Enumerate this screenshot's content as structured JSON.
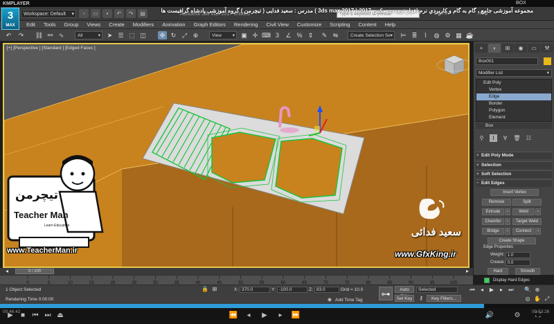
{
  "player": {
    "brand": "KMPLAYER",
    "video_title": "مجموعه آموزشی جامع ، گام به گام و کاربردی نرم افزار تری دی مکس 2017 ( 3ds max 2017 ) مدرس : سعید فدایی ( تیچرمن ) گروه آموزشی پادشاه گرافیست ها",
    "corner_label": "BOX",
    "time_elapsed": "00:46:42",
    "time_total": "00:53:26",
    "progress_fraction": 0.874
  },
  "app": {
    "logo": "3",
    "logo_sub": "MAX",
    "workspace": "Workspace: Default",
    "title": "Autodesk 3ds Max 2017    Untitled",
    "search_placeholder": "Type a keyword or phrase",
    "signin": "Sign In",
    "help": "Help"
  },
  "menu": [
    "File",
    "Edit",
    "Tools",
    "Group",
    "Views",
    "Create",
    "Modifiers",
    "Animation",
    "Graph Editors",
    "Rendering",
    "Civil View",
    "Customize",
    "Scripting",
    "Content",
    "Help"
  ],
  "toolbar": {
    "filter": "All",
    "coord": "View",
    "selection_set": "Create Selection Se"
  },
  "viewport": {
    "label": "[+] [Perspective ] [Standard ] [Edged Faces ]"
  },
  "command_panel": {
    "object_name": "Box001",
    "object_color": "#e8b818",
    "modifier_list": "Modifier List",
    "stack": [
      {
        "label": "Edit Poly",
        "level": 0
      },
      {
        "label": "Vertex",
        "level": 1
      },
      {
        "label": "Edge",
        "level": 1,
        "selected": true
      },
      {
        "label": "Border",
        "level": 1
      },
      {
        "label": "Polygon",
        "level": 1
      },
      {
        "label": "Element",
        "level": 1
      }
    ],
    "base_object": "Box",
    "rollouts": {
      "mode": "Edit Poly Mode",
      "selection": "Selection",
      "soft_selection": "Soft Selection",
      "edit_edges": "Edit Edges"
    },
    "buttons": {
      "insert_vertex": "Insert Vertex",
      "remove": "Remove",
      "split": "Split",
      "extrude": "Extrude",
      "weld": "Weld",
      "chamfer": "Chamfer",
      "target_weld": "Target Weld",
      "bridge": "Bridge",
      "connect": "Connect",
      "create_shape": "Create Shape"
    },
    "edge_properties": {
      "title": "Edge Properties",
      "weight_label": "Weight:",
      "weight_value": "1.0",
      "crease_label": "Crease:",
      "crease_value": "0.0",
      "hard": "Hard",
      "smooth": "Smooth",
      "display_hard": "Display Hard Edges"
    }
  },
  "timeline": {
    "frame": "0 / 100",
    "ticks": [
      "0",
      "5",
      "10",
      "15",
      "20",
      "25",
      "30",
      "35",
      "40",
      "45",
      "50",
      "55",
      "60",
      "65",
      "70",
      "75",
      "80",
      "85",
      "90",
      "95",
      "100"
    ]
  },
  "status": {
    "selected": "1 Object Selected",
    "rendering": "Rendering Time  0:00:00",
    "x_label": "X:",
    "x_value": "370.0",
    "y_label": "Y:",
    "y_value": "-100.0",
    "z_label": "Z:",
    "z_value": "83.0",
    "grid": "Grid = 10.0",
    "add_time_tag": "Add Time Tag",
    "auto_key": "Auto Key",
    "set_key": "Set Key",
    "selected_dropdown": "Selected",
    "key_filters": "Key Filters..."
  },
  "watermarks": {
    "teacher_url": "www.TeacherMan.ir",
    "teacher_persian": "تیچرمن",
    "teacher_sub": "Teacher Man",
    "teacher_learn": "Learn    Education",
    "gfx_name": "سعید فدائی",
    "gfx_url": "www.GfxKing.ir"
  }
}
